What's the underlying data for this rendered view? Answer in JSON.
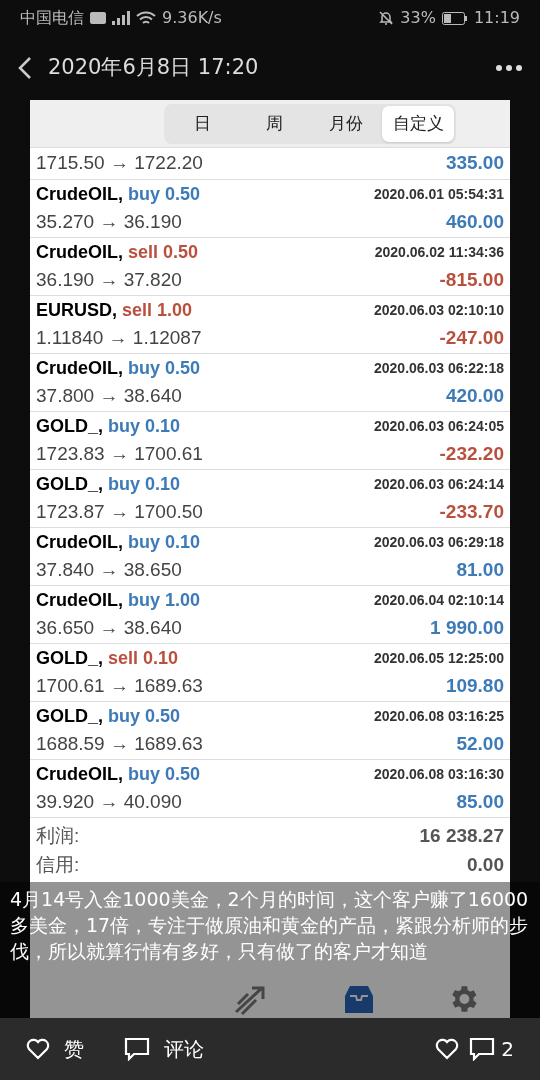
{
  "status_bar": {
    "carrier": "中国电信",
    "speed": "9.36K/s",
    "battery": "33%",
    "time": "11:19"
  },
  "header": {
    "title": "2020年6月8日 17:20"
  },
  "tabs": [
    {
      "label": "日",
      "selected": false
    },
    {
      "label": "周",
      "selected": false
    },
    {
      "label": "月份",
      "selected": false
    },
    {
      "label": "自定义",
      "selected": true
    }
  ],
  "partial_row": {
    "prices": "1715.50 → 1722.20",
    "profit": "335.00",
    "loss": false
  },
  "trades": [
    {
      "symbol": "CrudeOIL,",
      "volume": "buy 0.50",
      "color": "#3d7ab8",
      "time": "2020.06.01 05:54:31",
      "prices": "35.270 → 36.190",
      "profit": "460.00",
      "loss": false
    },
    {
      "symbol": "CrudeOIL,",
      "volume": "sell 0.50",
      "color": "#b9503e",
      "time": "2020.06.02 11:34:36",
      "prices": "36.190 → 37.820",
      "profit": "-815.00",
      "loss": true
    },
    {
      "symbol": "EURUSD,",
      "volume": "sell 1.00",
      "color": "#b9503e",
      "time": "2020.06.03 02:10:10",
      "prices": "1.11840 → 1.12087",
      "profit": "-247.00",
      "loss": true
    },
    {
      "symbol": "CrudeOIL,",
      "volume": "buy 0.50",
      "color": "#3d7ab8",
      "time": "2020.06.03 06:22:18",
      "prices": "37.800 → 38.640",
      "profit": "420.00",
      "loss": false
    },
    {
      "symbol": "GOLD_,",
      "volume": "buy 0.10",
      "color": "#3d7ab8",
      "time": "2020.06.03 06:24:05",
      "prices": "1723.83 → 1700.61",
      "profit": "-232.20",
      "loss": true
    },
    {
      "symbol": "GOLD_,",
      "volume": "buy 0.10",
      "color": "#3d7ab8",
      "time": "2020.06.03 06:24:14",
      "prices": "1723.87 → 1700.50",
      "profit": "-233.70",
      "loss": true
    },
    {
      "symbol": "CrudeOIL,",
      "volume": "buy 0.10",
      "color": "#3d7ab8",
      "time": "2020.06.03 06:29:18",
      "prices": "37.840 → 38.650",
      "profit": "81.00",
      "loss": false
    },
    {
      "symbol": "CrudeOIL,",
      "volume": "buy 1.00",
      "color": "#3d7ab8",
      "time": "2020.06.04 02:10:14",
      "prices": "36.650 → 38.640",
      "profit": "1 990.00",
      "loss": false
    },
    {
      "symbol": "GOLD_,",
      "volume": "sell 0.10",
      "color": "#b9503e",
      "time": "2020.06.05 12:25:00",
      "prices": "1700.61 → 1689.63",
      "profit": "109.80",
      "loss": false
    },
    {
      "symbol": "GOLD_,",
      "volume": "buy 0.50",
      "color": "#3d7ab8",
      "time": "2020.06.08 03:16:25",
      "prices": "1688.59 → 1689.63",
      "profit": "52.00",
      "loss": false
    },
    {
      "symbol": "CrudeOIL,",
      "volume": "buy 0.50",
      "color": "#3d7ab8",
      "time": "2020.06.08 03:16:30",
      "prices": "39.920 → 40.090",
      "profit": "85.00",
      "loss": false
    }
  ],
  "summary": [
    {
      "label": "利润:",
      "value": "16 238.27"
    },
    {
      "label": "信用:",
      "value": "0.00"
    }
  ],
  "toolbar": [
    {
      "kind": "trend",
      "selected": false
    },
    {
      "kind": "inbox",
      "selected": true
    },
    {
      "kind": "gear",
      "selected": false
    }
  ],
  "caption": "4月14号入金1000美金，2个月的时间，这个客户赚了16000多美金，17倍，专注于做原油和黄金的产品，紧跟分析师的步伐，所以就算行情有多好，只有做了的客户才知道",
  "actions": {
    "like": "赞",
    "comment": "评论",
    "comment_count": "2"
  }
}
